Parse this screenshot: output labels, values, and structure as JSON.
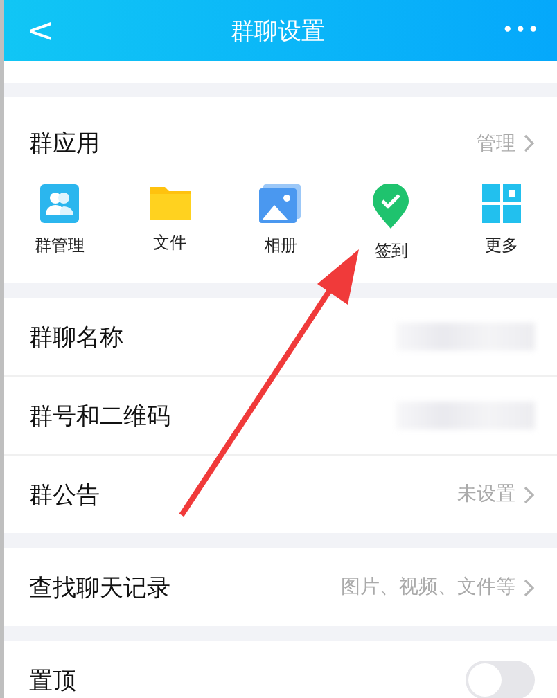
{
  "header": {
    "back": "<",
    "title": "群聊设置",
    "more": "•••"
  },
  "apps_section": {
    "title": "群应用",
    "action": "管理",
    "apps": [
      {
        "kind": "members",
        "label": "群管理"
      },
      {
        "kind": "folder",
        "label": "文件"
      },
      {
        "kind": "album",
        "label": "相册"
      },
      {
        "kind": "checkin",
        "label": "签到"
      },
      {
        "kind": "grid",
        "label": "更多"
      }
    ]
  },
  "info_rows": [
    {
      "kind": "blurred",
      "label": "群聊名称"
    },
    {
      "kind": "blurred",
      "label": "群号和二维码"
    },
    {
      "kind": "value",
      "label": "群公告",
      "value": "未设置"
    }
  ],
  "search_row": {
    "label": "查找聊天记录",
    "value": "图片、视频、文件等"
  },
  "pin_row": {
    "label": "置顶",
    "on": false
  },
  "annotation": {
    "kind": "arrow"
  }
}
